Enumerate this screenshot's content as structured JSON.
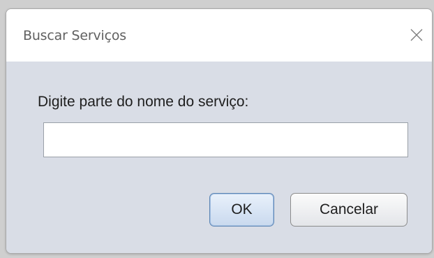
{
  "dialog": {
    "title": "Buscar Serviços",
    "prompt": "Digite parte do nome do serviço:",
    "input": {
      "value": "",
      "placeholder": ""
    },
    "buttons": {
      "ok_label": "OK",
      "cancel_label": "Cancelar"
    },
    "close_icon": "close-icon"
  },
  "colors": {
    "titlebar_bg": "#ffffff",
    "content_bg": "#d9dde6",
    "ok_border": "#5d86b5"
  }
}
